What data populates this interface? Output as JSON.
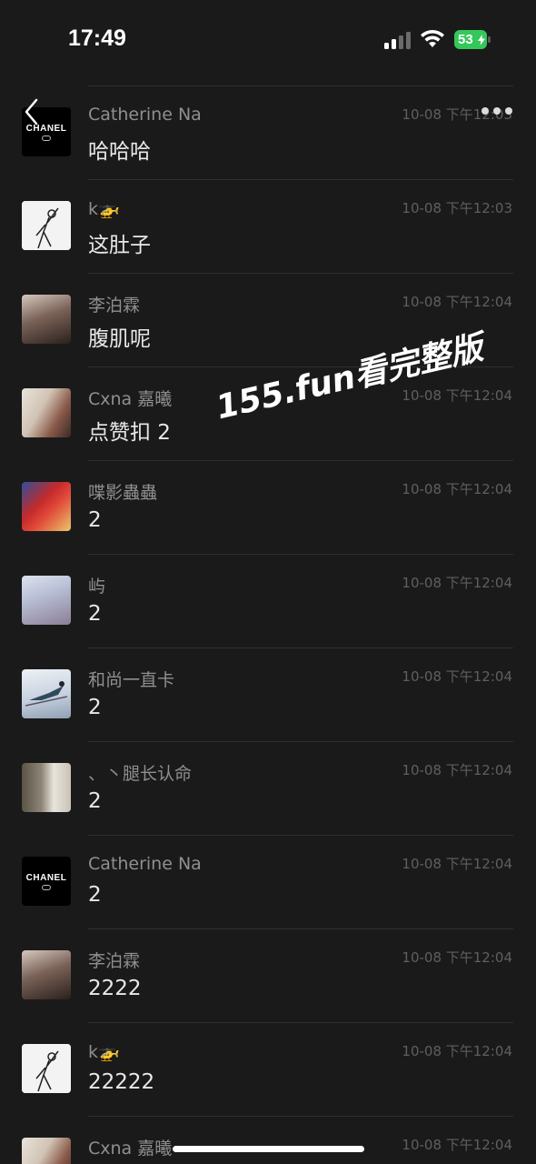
{
  "status_bar": {
    "time": "17:49",
    "battery": "53"
  },
  "watermark": "155.fun看完整版",
  "comments": [
    {
      "avatar": "chanel-logo",
      "name": "Catherine Na",
      "message": "哈哈哈",
      "time": "10-08 下午12:03"
    },
    {
      "avatar": "sketch-figure",
      "name": "k🚁",
      "message": "这肚子",
      "time": "10-08 下午12:03"
    },
    {
      "avatar": "woman-portrait",
      "name": "李泊霖",
      "message": "腹肌呢",
      "time": "10-08 下午12:04"
    },
    {
      "avatar": "selfie-with-cat",
      "name": "Cxna 嘉曦",
      "message": "点赞扣 2",
      "time": "10-08 下午12:04"
    },
    {
      "avatar": "spiderman",
      "name": "喋影蟲蟲",
      "message": "2",
      "time": "10-08 下午12:04"
    },
    {
      "avatar": "girl-photo",
      "name": "屿",
      "message": "2",
      "time": "10-08 下午12:04"
    },
    {
      "avatar": "skier",
      "name": "和尚一直卡",
      "message": "2",
      "time": "10-08 下午12:04"
    },
    {
      "avatar": "room-photo",
      "name": "、丶腿长认命",
      "message": "2",
      "time": "10-08 下午12:04"
    },
    {
      "avatar": "chanel-logo",
      "name": "Catherine Na",
      "message": "2",
      "time": "10-08 下午12:04"
    },
    {
      "avatar": "woman-portrait",
      "name": "李泊霖",
      "message": "2222",
      "time": "10-08 下午12:04"
    },
    {
      "avatar": "sketch-figure",
      "name": "k🚁",
      "message": "22222",
      "time": "10-08 下午12:04"
    },
    {
      "avatar": "selfie-with-cat",
      "name": "Cxna 嘉曦",
      "message": "",
      "time": "10-08 下午12:04"
    }
  ],
  "chanel_text": "CHANEL"
}
